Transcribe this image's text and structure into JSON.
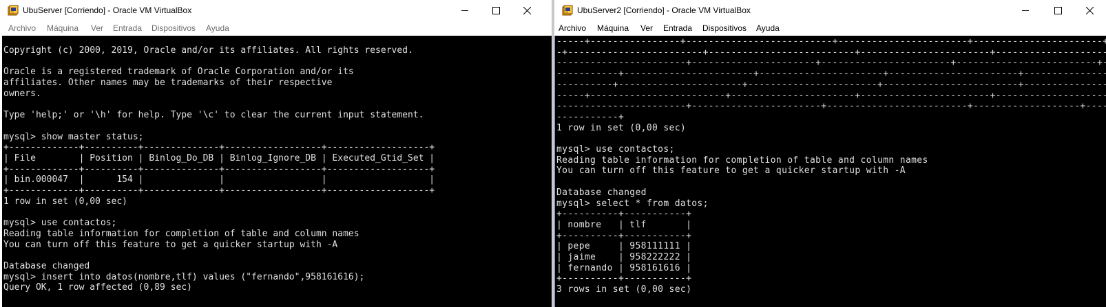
{
  "windows": [
    {
      "id": "ubuserver",
      "title": "UbuServer [Corriendo] - Oracle VM VirtualBox",
      "menu": [
        "Archivo",
        "Máquina",
        "Ver",
        "Entrada",
        "Dispositivos",
        "Ayuda"
      ],
      "console": "Copyright (c) 2000, 2019, Oracle and/or its affiliates. All rights reserved.\n\nOracle is a registered trademark of Oracle Corporation and/or its\naffiliates. Other names may be trademarks of their respective\nowners.\n\nType 'help;' or '\\h' for help. Type '\\c' to clear the current input statement.\n\nmysql> show master status;\n+-------------+----------+--------------+------------------+-------------------+\n| File        | Position | Binlog_Do_DB | Binlog_Ignore_DB | Executed_Gtid_Set |\n+-------------+----------+--------------+------------------+-------------------+\n| bin.000047  |      154 |              |                  |                   |\n+-------------+----------+--------------+------------------+-------------------+\n1 row in set (0,00 sec)\n\nmysql> use contactos;\nReading table information for completion of table and column names\nYou can turn off this feature to get a quicker startup with -A\n\nDatabase changed\nmysql> insert into datos(nombre,tlf) values (\"fernando\",958161616);\nQuery OK, 1 row affected (0,89 sec)"
    },
    {
      "id": "ubuserver2",
      "title": "UbuServer2 [Corriendo] - Oracle VM VirtualBox",
      "menu": [
        "Archivo",
        "Máquina",
        "Ver",
        "Entrada",
        "Dispositivos",
        "Ayuda"
      ],
      "console": "-----+----------------+--------------------------+-----------------------+-----------------------+----------------------+----------------------\n-+------------------------+--------------------------+-----------------------+----------------------+----------------------+--------------------\n-----------------------+----------------------+-----------------------+-------------------------+-------------------+--------------------+-----\n-----------+-----------------------+----------------------+-----------------------+-------------------------+-------------------+----------------\n----------+----------------------+-----------------------+------------------------+--------------------+--------------------+-----------------\n-----+------------------------+----------------------+-----------------------+-------------------------+-------------------+-------------------\n-----------------------+-----------------------+-------------------------+-------------------+--------------------+----------------------------\n-----------+\n1 row in set (0,00 sec)\n\nmysql> use contactos;\nReading table information for completion of table and column names\nYou can turn off this feature to get a quicker startup with -A\n\nDatabase changed\nmysql> select * from datos;\n+----------+-----------+\n| nombre   | tlf       |\n+----------+-----------+\n| pepe     | 958111111 |\n| jaime    | 958222222 |\n| fernando | 958161616 |\n+----------+-----------+\n3 rows in set (0,00 sec)"
    }
  ],
  "icons": {
    "app": "virtualbox-icon",
    "minimize": "minimize-icon",
    "maximize": "maximize-icon",
    "close": "close-icon"
  },
  "colors": {
    "console_bg": "#000000",
    "console_fg": "#e0e0e0",
    "titlebar_bg": "#ffffff",
    "inactive_menu": "#6d6d6d",
    "active_menu": "#000000"
  }
}
